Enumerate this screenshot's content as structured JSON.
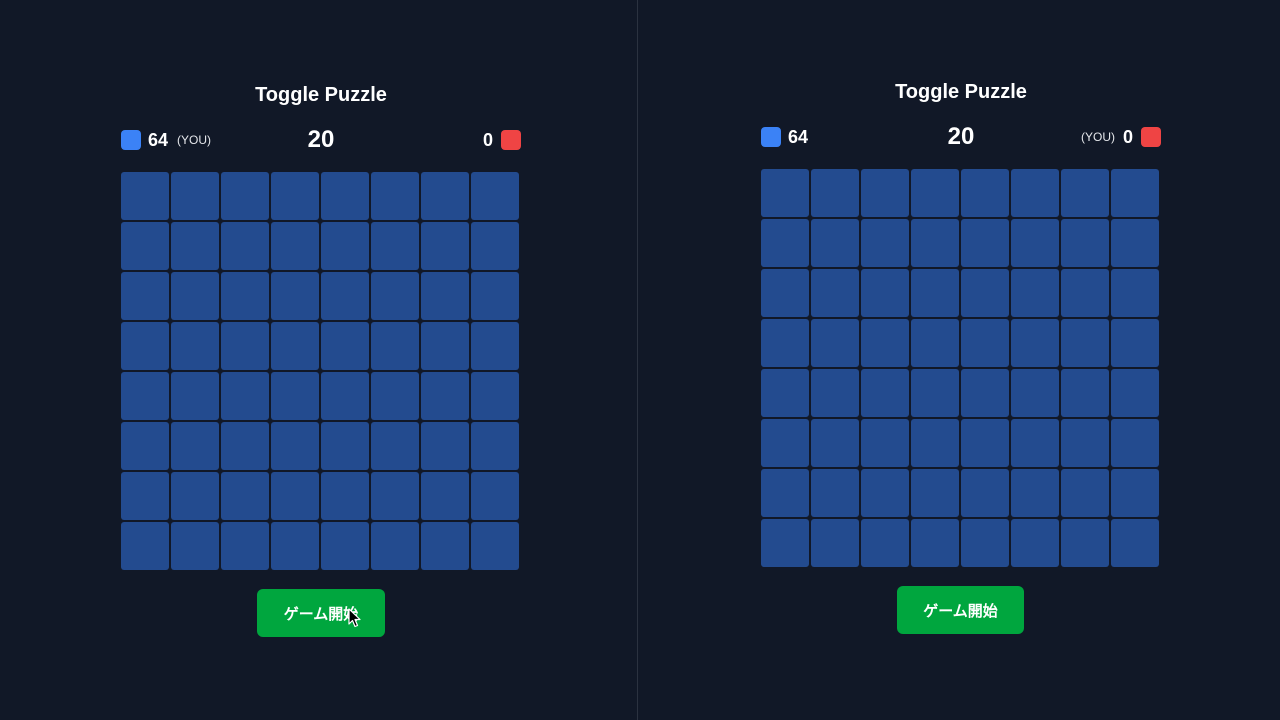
{
  "colors": {
    "background": "#111827",
    "blue_player": "#3b82f6",
    "red_player": "#ef4444",
    "tile": "#234b8f",
    "start_button": "#00a63e"
  },
  "grid": {
    "rows": 8,
    "cols": 8
  },
  "panels": [
    {
      "title": "Toggle Puzzle",
      "blue_score": "64",
      "red_score": "0",
      "timer": "20",
      "you_tag": "(YOU)",
      "you_side": "blue",
      "start_label": "ゲーム開始"
    },
    {
      "title": "Toggle Puzzle",
      "blue_score": "64",
      "red_score": "0",
      "timer": "20",
      "you_tag": "(YOU)",
      "you_side": "red",
      "start_label": "ゲーム開始"
    }
  ]
}
